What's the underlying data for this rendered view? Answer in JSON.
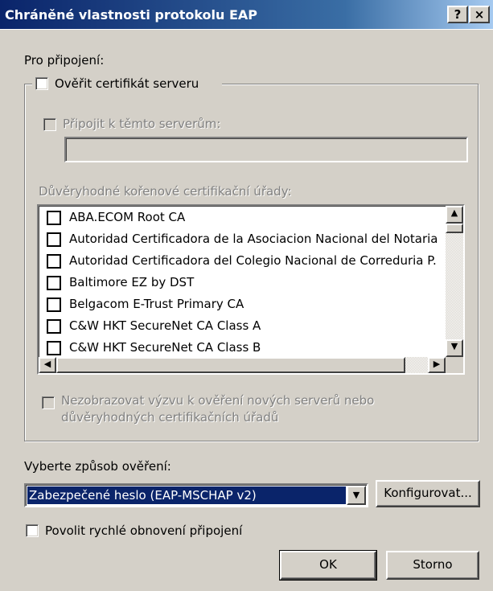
{
  "window": {
    "title": "Chráněné vlastnosti protokolu EAP",
    "help_label": "?",
    "close_label": "×"
  },
  "connection_label": "Pro připojení:",
  "verify_cert": {
    "label": "Ověřit certifikát serveru",
    "checked": false
  },
  "connect_servers": {
    "label": "Připojit k těmto serverům:",
    "value": ""
  },
  "trusted_roots": {
    "label": "Důvěryhodné kořenové certifikační úřady:",
    "items": [
      {
        "label": "ABA.ECOM Root CA",
        "checked": false
      },
      {
        "label": "Autoridad Certificadora de la Asociacion Nacional del Notaria",
        "checked": false
      },
      {
        "label": "Autoridad Certificadora del Colegio Nacional de Correduria P.",
        "checked": false
      },
      {
        "label": "Baltimore EZ by DST",
        "checked": false
      },
      {
        "label": "Belgacom E-Trust Primary CA",
        "checked": false
      },
      {
        "label": "C&W HKT SecureNet CA Class A",
        "checked": false
      },
      {
        "label": "C&W HKT SecureNet CA Class B",
        "checked": false
      }
    ]
  },
  "no_prompt": {
    "line1": "Nezobrazovat výzvu k ověření nových serverů nebo",
    "line2": "důvěryhodných certifikačních úřadů"
  },
  "auth_method": {
    "label": "Vyberte způsob ověření:",
    "selected": "Zabezpečené heslo (EAP-MSCHAP v2)",
    "configure_label": "Konfigurovat..."
  },
  "fast_reconnect": {
    "label": "Povolit rychlé obnovení připojení",
    "checked": false
  },
  "buttons": {
    "ok": "OK",
    "cancel": "Storno"
  }
}
